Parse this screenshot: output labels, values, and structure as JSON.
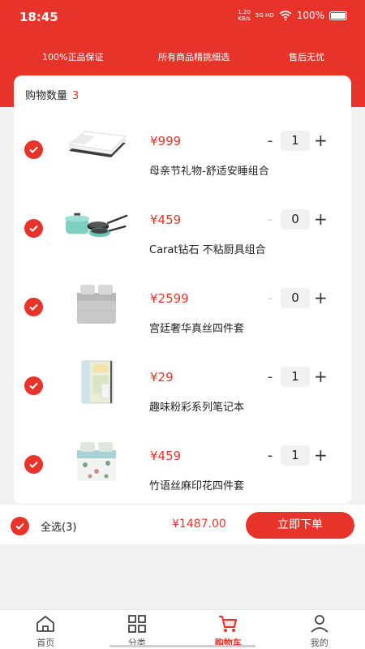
{
  "status_bar": {
    "time": "18:45",
    "net_speed_value": "1.20",
    "net_speed_unit": "KB/s",
    "signal_label": "5G HD",
    "battery": "100%"
  },
  "guarantees": [
    "100%正品保证",
    "所有商品精挑细选",
    "售后无忧"
  ],
  "cart": {
    "count_label": "购物数量",
    "count": "3",
    "items": [
      {
        "price": "¥999",
        "name": "母亲节礼物-舒适安睡组合",
        "quantity": "1",
        "image": "bedding-set-image"
      },
      {
        "price": "¥459",
        "name": "Carat钻石 不粘厨具组合",
        "quantity": "0",
        "image": "cookware-set-image"
      },
      {
        "price": "¥2599",
        "name": "宫廷奢华真丝四件套",
        "quantity": "0",
        "image": "silk-bedding-image"
      },
      {
        "price": "¥29",
        "name": "趣味粉彩系列笔记本",
        "quantity": "1",
        "image": "notebook-image"
      },
      {
        "price": "¥459",
        "name": "竹语丝麻印花四件套",
        "quantity": "1",
        "image": "floral-bedding-image"
      }
    ]
  },
  "controls": {
    "minus": "-",
    "plus": "+"
  },
  "footer": {
    "select_all": "全选(3)",
    "total": "¥1487.00",
    "order_button": "立即下单"
  },
  "tabs": [
    {
      "label": "首页",
      "icon": "home-icon"
    },
    {
      "label": "分类",
      "icon": "grid-icon"
    },
    {
      "label": "购物车",
      "icon": "cart-icon"
    },
    {
      "label": "我的",
      "icon": "user-icon"
    }
  ],
  "colors": {
    "accent": "#e8332a",
    "background": "#f2f2f2"
  }
}
